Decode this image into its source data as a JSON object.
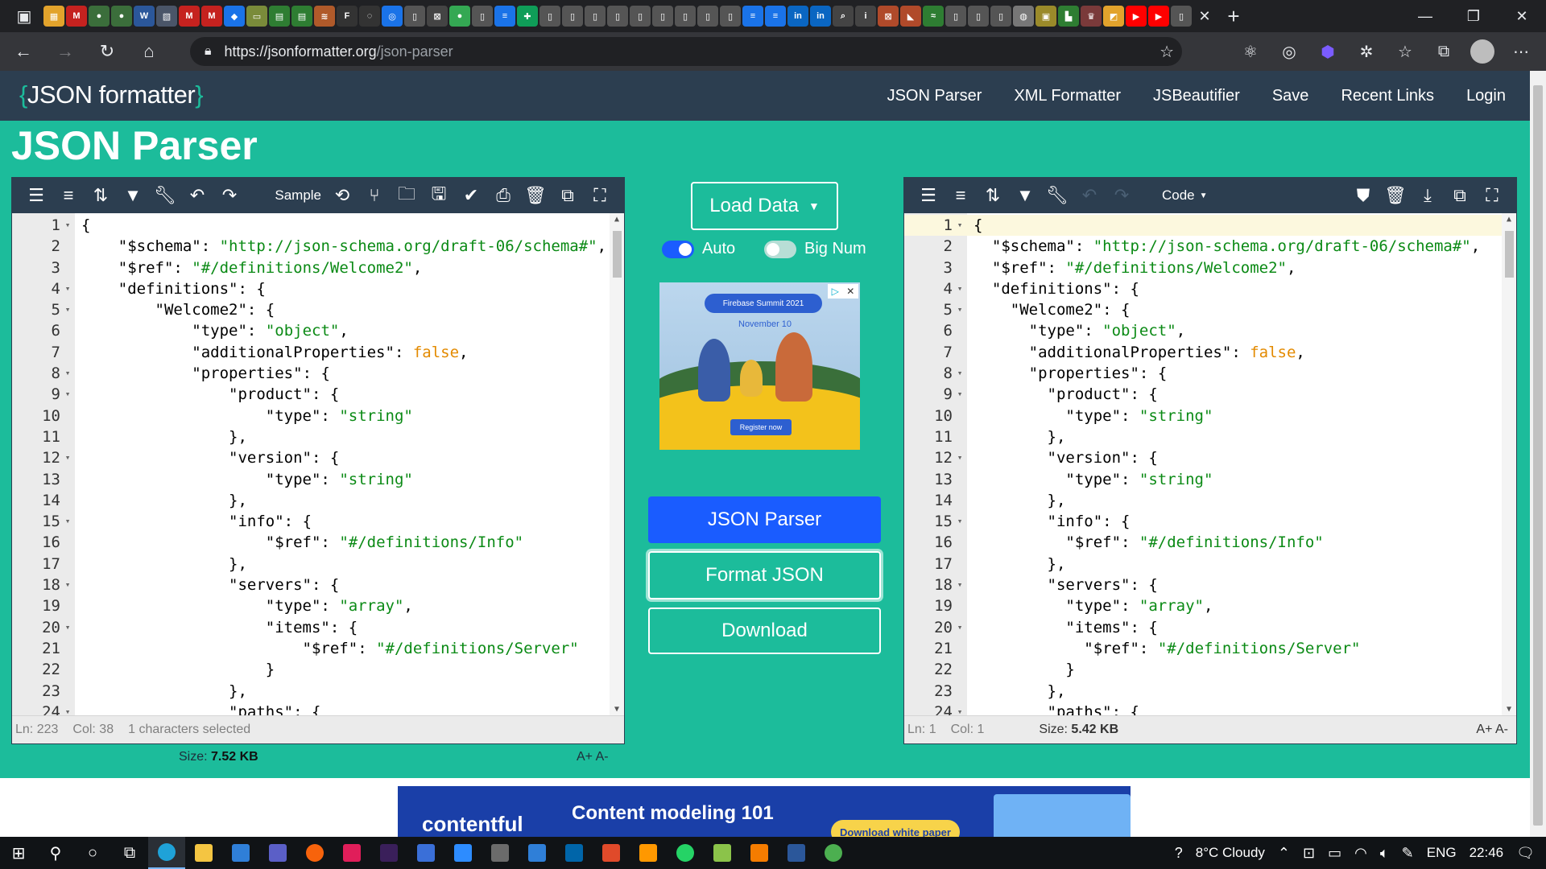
{
  "browser": {
    "url_host": "https://jsonformatter.org",
    "url_path": "/json-parser",
    "tab_close": "✕",
    "new_tab": "+"
  },
  "site": {
    "logo_open": "{",
    "logo_text": "JSON formatter",
    "logo_close": "}",
    "nav": [
      "JSON Parser",
      "XML Formatter",
      "JSBeautifier",
      "Save",
      "Recent Links",
      "Login"
    ],
    "page_title": "JSON Parser"
  },
  "left_editor": {
    "toolbar_sample": "Sample",
    "lines": [
      {
        "n": "1",
        "fold": true,
        "code": "{"
      },
      {
        "n": "2",
        "fold": false,
        "ind": 1,
        "key": "\"$schema\"",
        "val": "\"http://json-schema.org/draft-06/schema#\"",
        "vt": "s",
        "tail": ","
      },
      {
        "n": "3",
        "fold": false,
        "ind": 1,
        "key": "\"$ref\"",
        "val": "\"#/definitions/Welcome2\"",
        "vt": "s",
        "tail": ","
      },
      {
        "n": "4",
        "fold": true,
        "ind": 1,
        "key": "\"definitions\"",
        "val": "{",
        "vt": "k",
        "tail": ""
      },
      {
        "n": "5",
        "fold": true,
        "ind": 2,
        "key": "\"Welcome2\"",
        "val": "{",
        "vt": "k",
        "tail": ""
      },
      {
        "n": "6",
        "fold": false,
        "ind": 3,
        "key": "\"type\"",
        "val": "\"object\"",
        "vt": "s",
        "tail": ","
      },
      {
        "n": "7",
        "fold": false,
        "ind": 3,
        "key": "\"additionalProperties\"",
        "val": "false",
        "vt": "b",
        "tail": ","
      },
      {
        "n": "8",
        "fold": true,
        "ind": 3,
        "key": "\"properties\"",
        "val": "{",
        "vt": "k",
        "tail": ""
      },
      {
        "n": "9",
        "fold": true,
        "ind": 4,
        "key": "\"product\"",
        "val": "{",
        "vt": "k",
        "tail": ""
      },
      {
        "n": "10",
        "fold": false,
        "ind": 5,
        "key": "\"type\"",
        "val": "\"string\"",
        "vt": "s",
        "tail": ""
      },
      {
        "n": "11",
        "fold": false,
        "ind": 4,
        "code": "},"
      },
      {
        "n": "12",
        "fold": true,
        "ind": 4,
        "key": "\"version\"",
        "val": "{",
        "vt": "k",
        "tail": ""
      },
      {
        "n": "13",
        "fold": false,
        "ind": 5,
        "key": "\"type\"",
        "val": "\"string\"",
        "vt": "s",
        "tail": ""
      },
      {
        "n": "14",
        "fold": false,
        "ind": 4,
        "code": "},"
      },
      {
        "n": "15",
        "fold": true,
        "ind": 4,
        "key": "\"info\"",
        "val": "{",
        "vt": "k",
        "tail": ""
      },
      {
        "n": "16",
        "fold": false,
        "ind": 5,
        "key": "\"$ref\"",
        "val": "\"#/definitions/Info\"",
        "vt": "s",
        "tail": ""
      },
      {
        "n": "17",
        "fold": false,
        "ind": 4,
        "code": "},"
      },
      {
        "n": "18",
        "fold": true,
        "ind": 4,
        "key": "\"servers\"",
        "val": "{",
        "vt": "k",
        "tail": ""
      },
      {
        "n": "19",
        "fold": false,
        "ind": 5,
        "key": "\"type\"",
        "val": "\"array\"",
        "vt": "s",
        "tail": ","
      },
      {
        "n": "20",
        "fold": true,
        "ind": 5,
        "key": "\"items\"",
        "val": "{",
        "vt": "k",
        "tail": ""
      },
      {
        "n": "21",
        "fold": false,
        "ind": 6,
        "key": "\"$ref\"",
        "val": "\"#/definitions/Server\"",
        "vt": "s",
        "tail": ""
      },
      {
        "n": "22",
        "fold": false,
        "ind": 5,
        "code": "}"
      },
      {
        "n": "23",
        "fold": false,
        "ind": 4,
        "code": "},"
      },
      {
        "n": "24",
        "fold": true,
        "ind": 4,
        "key": "\"paths\"",
        "val": "{",
        "vt": "k",
        "tail": ""
      }
    ],
    "status_ln": "Ln: 223",
    "status_col": "Col: 38",
    "status_sel": "1 characters selected",
    "size_label": "Size:",
    "size_value": "7.52 KB",
    "font_size_ctrl": "A+  A-"
  },
  "middle": {
    "load_data": "Load Data",
    "auto_label": "Auto",
    "bignum_label": "Big Num",
    "auto_on": true,
    "bignum_on": false,
    "ad": {
      "pill": "Firebase Summit 2021",
      "date": "November 10",
      "register": "Register now"
    },
    "btn_parser": "JSON Parser",
    "btn_format": "Format JSON",
    "btn_download": "Download"
  },
  "right_editor": {
    "toolbar_mode": "Code",
    "status_ln": "Ln: 1",
    "status_col": "Col: 1",
    "size_label": "Size:",
    "size_value": "5.42 KB",
    "font_size_ctrl": "A+  A-"
  },
  "banner": {
    "brand": "contentful",
    "headline": "Content modeling 101",
    "cta": "Download white paper"
  },
  "taskbar": {
    "weather": "8°C  Cloudy",
    "lang": "ENG",
    "time": "22:46"
  },
  "colors": {
    "page_bg": "#1cbc9b",
    "header_bg": "#2c3e50",
    "primary_button": "#1a5cff",
    "string_value": "#0b8a15",
    "boolean_value": "#e38a00"
  }
}
